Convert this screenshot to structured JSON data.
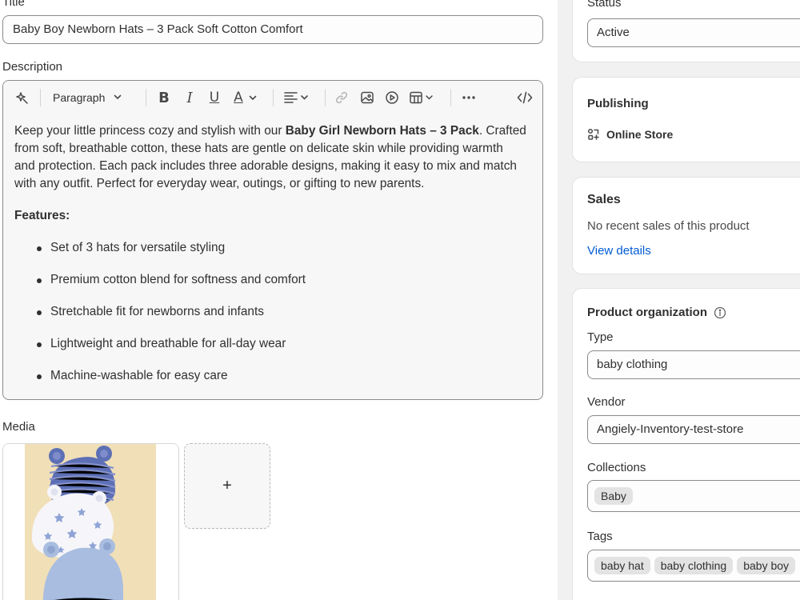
{
  "product": {
    "title_label": "Title",
    "title_value": "Baby Boy Newborn Hats – 3 Pack Soft Cotton Comfort",
    "description_label": "Description",
    "toolbar": {
      "paragraph_style": "Paragraph",
      "bold": "B",
      "italic": "I",
      "underline": "U",
      "text_color": "A"
    },
    "description": {
      "intro_before": "Keep your little princess cozy and stylish with our ",
      "intro_bold": "Baby Girl Newborn Hats – 3 Pack",
      "intro_line1_after": ". Crafted",
      "intro_line2": "from soft, breathable cotton, these hats are gentle on delicate skin while providing warmth",
      "intro_line3": "and protection. Each pack includes three adorable designs, making it easy to mix and match",
      "intro_line4": "with any outfit. Perfect for everyday wear, outings, or gifting to new parents.",
      "features_heading": "Features:",
      "features": [
        "Set of 3 hats for versatile styling",
        "Premium cotton blend for softness and comfort",
        "Stretchable fit for newborns and infants",
        "Lightweight and breathable for all-day wear",
        "Machine-washable for easy care"
      ]
    },
    "media_label": "Media",
    "add_media_symbol": "+"
  },
  "sidebar": {
    "status": {
      "label": "Status",
      "value": "Active"
    },
    "publishing": {
      "title": "Publishing",
      "channel": "Online Store"
    },
    "sales": {
      "title": "Sales",
      "message": "No recent sales of this product",
      "link": "View details"
    },
    "organization": {
      "title": "Product organization",
      "type_label": "Type",
      "type_value": "baby clothing",
      "vendor_label": "Vendor",
      "vendor_value": "Angiely-Inventory-test-store",
      "collections_label": "Collections",
      "collections": [
        "Baby"
      ],
      "tags_label": "Tags",
      "tags": [
        "baby hat",
        "baby clothing",
        "baby boy"
      ]
    }
  },
  "colors": {
    "link": "#005bd3",
    "page_bg": "#f1f1f1",
    "chip_bg": "#e3e3e3",
    "hat_blue_stripe": "#5d6fb5",
    "hat_stars": "#8fa3d6",
    "hat_light_blue": "#a9bde0",
    "photo_bg": "#f1dfb8"
  },
  "icons": [
    "magic-icon",
    "chevron-down-icon",
    "align-left-icon",
    "link-icon",
    "image-icon",
    "video-icon",
    "table-icon",
    "more-icon",
    "code-icon",
    "store-icon",
    "info-icon",
    "plus-icon"
  ]
}
